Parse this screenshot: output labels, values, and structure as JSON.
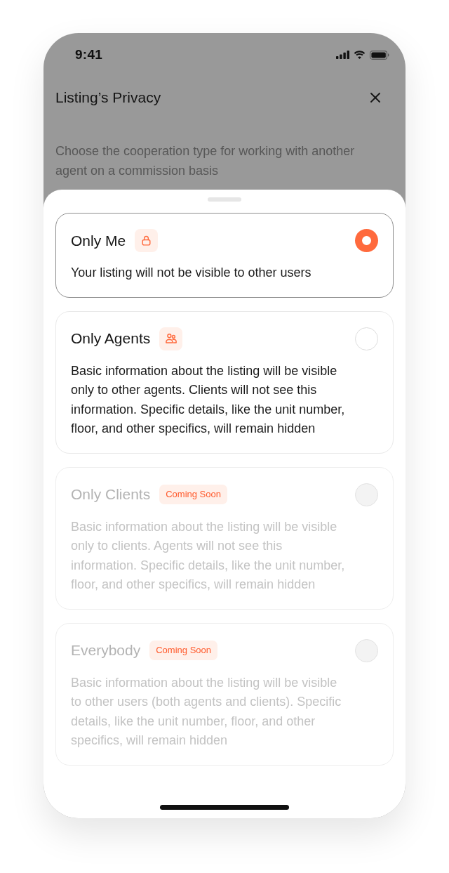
{
  "status_bar": {
    "time": "9:41"
  },
  "header": {
    "title": "Listing’s Privacy",
    "subtitle": "Choose the cooperation type for working with another agent on a commission basis"
  },
  "options": [
    {
      "title": "Only Me",
      "description": "Your listing will not be visible to other users",
      "selected": true,
      "disabled": false
    },
    {
      "title": "Only Agents",
      "description": "Basic information about the listing will be visible only to other agents. Clients will not see this information. Specific details, like the unit number, floor, and other specifics, will remain hidden",
      "selected": false,
      "disabled": false
    },
    {
      "title": "Only Clients",
      "badge": "Coming Soon",
      "description": "Basic information about the listing will be visible only to clients. Agents will not see this information. Specific details, like the unit number, floor, and other specifics, will remain hidden",
      "selected": false,
      "disabled": true
    },
    {
      "title": "Everybody",
      "badge": "Coming Soon",
      "description": "Basic information about the listing will be visible to other users (both agents and clients). Specific details, like the unit number, floor, and other specifics, will remain hidden",
      "selected": false,
      "disabled": true
    }
  ]
}
